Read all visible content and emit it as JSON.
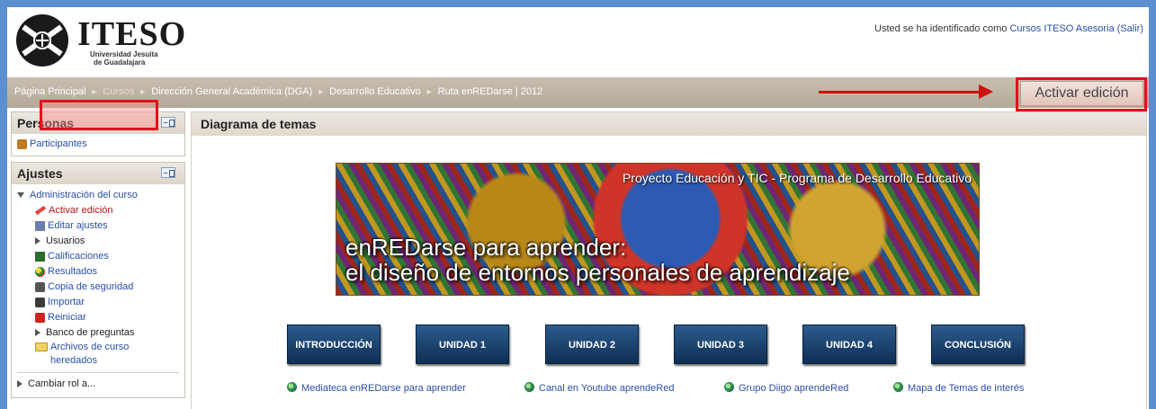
{
  "header": {
    "logo_name": "ITESO",
    "logo_sub1": "Universidad Jesuita",
    "logo_sub2": "de Guadalajara",
    "login_prefix": "Usted se ha identificado como ",
    "login_user": "Cursos ITESO Asesoria",
    "login_logout": "(Salir)"
  },
  "breadcrumb": {
    "items": [
      "Página Principal",
      "Cursos",
      "Dirección General Académica (DGA)",
      "Desarrollo Educativo",
      "Ruta enREDarse | 2012"
    ],
    "separator": "►"
  },
  "toolbar": {
    "activar_label": "Activar edición"
  },
  "sidebar": {
    "personas": {
      "title": "Personas",
      "participantes": "Participantes"
    },
    "ajustes": {
      "title": "Ajustes",
      "admin_label": "Administración del curso",
      "items": [
        "Activar edición",
        "Editar ajustes",
        "Usuarios",
        "Calificaciones",
        "Resultados",
        "Copia de seguridad",
        "Importar",
        "Reiniciar",
        "Banco de preguntas",
        "Archivos de curso",
        "heredados"
      ],
      "cambiar_rol": "Cambiar rol a..."
    }
  },
  "main": {
    "title": "Diagrama de temas",
    "banner": {
      "top_text": "Proyecto Educación y TIC - Programa de Desarrollo Educativo",
      "line1": "enREDarse para aprender:",
      "line2": "el diseño de entornos personales de aprendizaje"
    },
    "nav_buttons": [
      "INTRODUCCIÓN",
      "UNIDAD 1",
      "UNIDAD 2",
      "UNIDAD 3",
      "UNIDAD 4",
      "CONCLUSIÓN"
    ],
    "resource_links": [
      "Mediateca enREDarse para aprender",
      "Canal en Youtube aprendeRed",
      "Grupo Diigo aprendeRed",
      "Mapa de Temas de interés"
    ]
  },
  "colors": {
    "frame_border": "#5b8fcf",
    "highlight_red": "#e0101c",
    "link_blue": "#2a4ea8",
    "nav_button_blue": "#1a4270"
  }
}
